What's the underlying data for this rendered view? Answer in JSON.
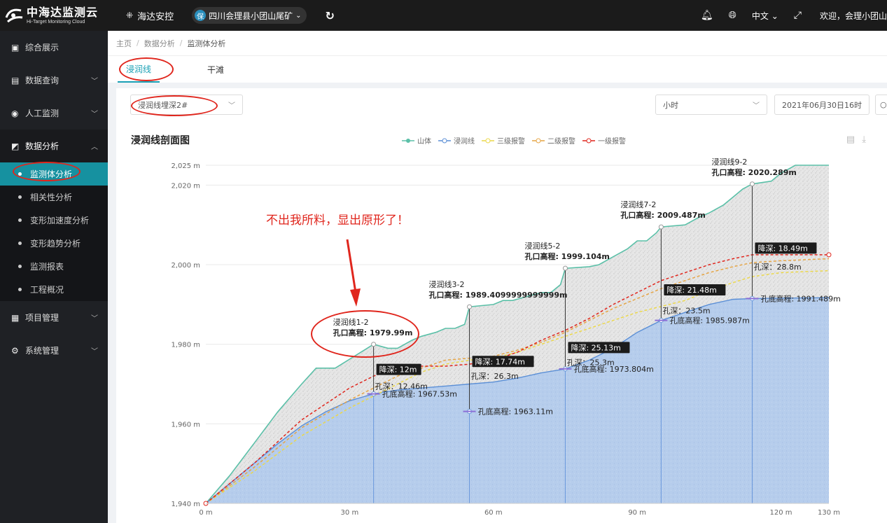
{
  "header": {
    "logo_main": "中海达监测云",
    "logo_sub": "Hi-Target Monitoring Cloud",
    "app_name": "海达安控",
    "project_badge": "保",
    "project_name": "四川会理县小团山尾矿",
    "language": "中文",
    "welcome": "欢迎，会理小团山"
  },
  "sidebar": {
    "items": [
      {
        "label": "综合展示",
        "icon": "dashboard-icon"
      },
      {
        "label": "数据查询",
        "icon": "data-query-icon"
      },
      {
        "label": "人工监测",
        "icon": "manual-monitor-icon"
      },
      {
        "label": "数据分析",
        "icon": "data-analysis-icon"
      },
      {
        "label": "项目管理",
        "icon": "project-icon"
      },
      {
        "label": "系统管理",
        "icon": "settings-icon"
      }
    ],
    "sub_items": [
      "监测体分析",
      "相关性分析",
      "变形加速度分析",
      "变形趋势分析",
      "监测报表",
      "工程概况"
    ]
  },
  "breadcrumb": [
    "主页",
    "数据分析",
    "监测体分析"
  ],
  "tabs": [
    "浸润线",
    "干滩"
  ],
  "filters": {
    "point_select": "浸润线埋深2#",
    "interval_select": "小时",
    "date": "2021年06月30日16时"
  },
  "annotation_text": "不出我所料，显出原形了！",
  "chart_data": {
    "type": "area",
    "title": "浸润线剖面图",
    "legend": [
      "山体",
      "浸润线",
      "三级报警",
      "二级报警",
      "一级报警"
    ],
    "x_ticks": [
      "0 m",
      "30 m",
      "60 m",
      "90 m",
      "120 m",
      "130 m"
    ],
    "x_tick_values": [
      0,
      30,
      60,
      90,
      120,
      130
    ],
    "y_ticks": [
      "1,940 m",
      "1,960 m",
      "1,980 m",
      "2,000 m",
      "2,020 m",
      "2,025 m"
    ],
    "y_tick_values": [
      1940,
      1960,
      1980,
      2000,
      2020,
      2025
    ],
    "xlim": [
      0,
      130
    ],
    "ylim": [
      1940,
      2025
    ],
    "mountain": [
      [
        0,
        1940
      ],
      [
        5,
        1947
      ],
      [
        10,
        1955
      ],
      [
        15,
        1963
      ],
      [
        20,
        1970
      ],
      [
        23,
        1974
      ],
      [
        27,
        1974
      ],
      [
        35,
        1979.99
      ],
      [
        38,
        1979
      ],
      [
        40,
        1979
      ],
      [
        43,
        1981
      ],
      [
        45,
        1982
      ],
      [
        48,
        1983
      ],
      [
        50,
        1984
      ],
      [
        52,
        1984
      ],
      [
        54,
        1985
      ],
      [
        55,
        1989.41
      ],
      [
        60,
        1990
      ],
      [
        62,
        1991
      ],
      [
        64,
        1991
      ],
      [
        67,
        1992
      ],
      [
        70,
        1993
      ],
      [
        72,
        1993
      ],
      [
        74,
        1995
      ],
      [
        75,
        1999.1
      ],
      [
        80,
        1999.5
      ],
      [
        82,
        2000
      ],
      [
        85,
        2002
      ],
      [
        88,
        2004
      ],
      [
        90,
        2006
      ],
      [
        92,
        2006
      ],
      [
        94,
        2008
      ],
      [
        95,
        2009.49
      ],
      [
        100,
        2010
      ],
      [
        103,
        2012
      ],
      [
        105,
        2013
      ],
      [
        108,
        2015
      ],
      [
        110,
        2017
      ],
      [
        112,
        2019
      ],
      [
        114,
        2020.29
      ],
      [
        118,
        2021
      ],
      [
        120,
        2023
      ],
      [
        123,
        2025
      ],
      [
        130,
        2025
      ]
    ],
    "phreatic": [
      [
        0,
        1940
      ],
      [
        5,
        1945
      ],
      [
        10,
        1950
      ],
      [
        15,
        1955
      ],
      [
        20,
        1959.5
      ],
      [
        25,
        1963
      ],
      [
        30,
        1965.8
      ],
      [
        35,
        1967.53
      ],
      [
        40,
        1968.5
      ],
      [
        45,
        1969
      ],
      [
        50,
        1969.5
      ],
      [
        55,
        1970
      ],
      [
        60,
        1970.5
      ],
      [
        65,
        1971.5
      ],
      [
        70,
        1972.8
      ],
      [
        75,
        1973.8
      ],
      [
        80,
        1976
      ],
      [
        85,
        1979
      ],
      [
        90,
        1983
      ],
      [
        95,
        1985.99
      ],
      [
        100,
        1988
      ],
      [
        105,
        1990
      ],
      [
        110,
        1991.3
      ],
      [
        114,
        1991.49
      ],
      [
        120,
        1991.6
      ],
      [
        130,
        1991.7
      ]
    ],
    "alarm3": [
      [
        0,
        1940
      ],
      [
        10,
        1948
      ],
      [
        20,
        1957
      ],
      [
        30,
        1964
      ],
      [
        35,
        1967
      ],
      [
        40,
        1970
      ],
      [
        45,
        1973
      ],
      [
        50,
        1975
      ],
      [
        55,
        1976
      ],
      [
        60,
        1976.5
      ],
      [
        65,
        1978
      ],
      [
        70,
        1980
      ],
      [
        75,
        1982
      ],
      [
        80,
        1984
      ],
      [
        85,
        1986
      ],
      [
        90,
        1988
      ],
      [
        95,
        1989.5
      ],
      [
        100,
        1991
      ],
      [
        105,
        1993.5
      ],
      [
        110,
        1995.5
      ],
      [
        114,
        1997
      ],
      [
        120,
        1998
      ],
      [
        130,
        1998.5
      ]
    ],
    "alarm2": [
      [
        0,
        1940
      ],
      [
        10,
        1949
      ],
      [
        20,
        1959
      ],
      [
        30,
        1966
      ],
      [
        35,
        1969
      ],
      [
        40,
        1972
      ],
      [
        45,
        1974
      ],
      [
        50,
        1976
      ],
      [
        55,
        1976.5
      ],
      [
        60,
        1977
      ],
      [
        65,
        1978.5
      ],
      [
        70,
        1980.5
      ],
      [
        75,
        1983
      ],
      [
        80,
        1986
      ],
      [
        85,
        1989
      ],
      [
        90,
        1991.5
      ],
      [
        95,
        1994
      ],
      [
        100,
        1996
      ],
      [
        105,
        1998
      ],
      [
        110,
        1999.5
      ],
      [
        114,
        2000.5
      ],
      [
        120,
        2001
      ],
      [
        130,
        2001.5
      ]
    ],
    "alarm1": [
      [
        0,
        1940
      ],
      [
        10,
        1950
      ],
      [
        20,
        1961
      ],
      [
        30,
        1969
      ],
      [
        35,
        1972
      ],
      [
        40,
        1974
      ],
      [
        45,
        1974.5
      ],
      [
        50,
        1974.5
      ],
      [
        55,
        1975
      ],
      [
        60,
        1976
      ],
      [
        65,
        1978
      ],
      [
        70,
        1981
      ],
      [
        75,
        1983.5
      ],
      [
        80,
        1986.5
      ],
      [
        85,
        1990
      ],
      [
        90,
        1993
      ],
      [
        95,
        1996
      ],
      [
        100,
        1998
      ],
      [
        105,
        2000
      ],
      [
        110,
        2001.5
      ],
      [
        114,
        2002.5
      ],
      [
        120,
        2002.5
      ],
      [
        130,
        2002.5
      ]
    ],
    "wells": [
      {
        "x": 35,
        "name": "浸润线1-2",
        "top_label": "孔口高程: 1979.99m",
        "top": 1979.99,
        "depth_label": "降深: 12m",
        "depth_y": 1973.5,
        "hole_depth_label": "孔深：12.46m",
        "hole_depth_y": 1969.5,
        "bottom_label": "孔底高程: 1967.53m",
        "bottom": 1967.53
      },
      {
        "x": 55,
        "name": "浸润线3-2",
        "top_label": "孔口高程: 1989.4099999999999m",
        "top": 1989.41,
        "depth_label": "降深: 17.74m",
        "depth_y": 1975.5,
        "hole_depth_label": "孔深：26.3m",
        "hole_depth_y": 1972,
        "bottom_label": "孔底高程: 1963.11m",
        "bottom": 1963.11
      },
      {
        "x": 75,
        "name": "浸润线5-2",
        "top_label": "孔口高程: 1999.104m",
        "top": 1999.104,
        "depth_label": "降深: 25.13m",
        "depth_y": 1979,
        "hole_depth_label": "孔深：25.3m",
        "hole_depth_y": 1975.5,
        "bottom_label": "孔底高程: 1973.804m",
        "bottom": 1973.804
      },
      {
        "x": 95,
        "name": "浸润线7-2",
        "top_label": "孔口高程: 2009.487m",
        "top": 2009.487,
        "depth_label": "降深: 21.48m",
        "depth_y": 1993.5,
        "hole_depth_label": "孔深：23.5m",
        "hole_depth_y": 1988.5,
        "bottom_label": "孔底高程: 1985.987m",
        "bottom": 1985.987
      },
      {
        "x": 114,
        "name": "浸润线9-2",
        "top_label": "孔口高程: 2020.289m",
        "top": 2020.289,
        "depth_label": "降深: 18.49m",
        "depth_y": 2004,
        "hole_depth_label": "孔深：28.8m",
        "hole_depth_y": 1999.5,
        "bottom_label": "孔底高程: 1991.489m",
        "bottom": 1991.489
      }
    ]
  },
  "colors": {
    "accent": "#1aa0b5",
    "mountain_line": "#5bc0a8",
    "phreatic_line": "#5b8fd6",
    "alarm3": "#ecd84a",
    "alarm2": "#e6a545",
    "alarm1": "#e0261d",
    "annotation": "#e0261d"
  }
}
